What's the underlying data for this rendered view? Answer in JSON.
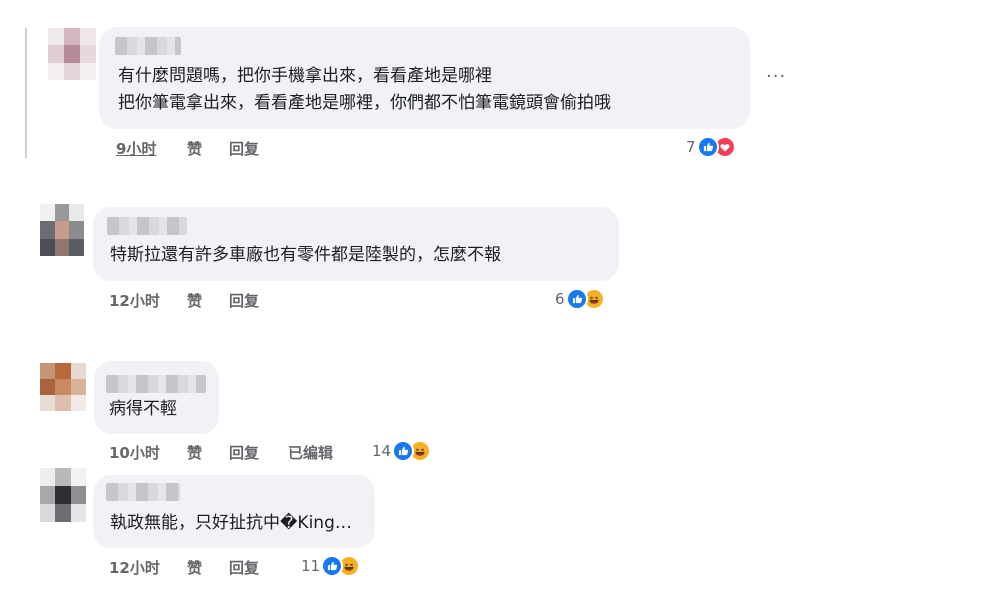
{
  "comments": [
    {
      "lines": [
        "有什麼問題嗎，把你手機拿出來，看看產地是哪裡",
        "把你筆電拿出來，看看產地是哪裡，你們都不怕筆電鏡頭會偷拍哦"
      ],
      "time": "9小时",
      "like": "赞",
      "reply": "回复",
      "reaction_count": "7",
      "reactions": [
        "like-icon",
        "love-icon"
      ]
    },
    {
      "lines": [
        "特斯拉還有許多車廠也有零件都是陸製的，怎麼不報"
      ],
      "time": "12小时",
      "like": "赞",
      "reply": "回复",
      "reaction_count": "6",
      "reactions": [
        "like-icon",
        "haha-icon"
      ]
    },
    {
      "lines": [
        "病得不輕"
      ],
      "time": "10小时",
      "like": "赞",
      "reply": "回复",
      "edited": "已编辑",
      "reaction_count": "14",
      "reactions": [
        "like-icon",
        "haha-icon"
      ]
    },
    {
      "lines": [
        "執政無能，只好扯抗中�King…"
      ],
      "time": "12小时",
      "like": "赞",
      "reply": "回复",
      "reaction_count": "11",
      "reactions": [
        "like-icon",
        "haha-icon"
      ]
    }
  ],
  "more_menu": "···",
  "colors": {
    "like": "#1877f2",
    "love": "#f33e58",
    "haha": "#f7b125",
    "bubble": "#f0f2f5",
    "meta": "#65676b"
  }
}
